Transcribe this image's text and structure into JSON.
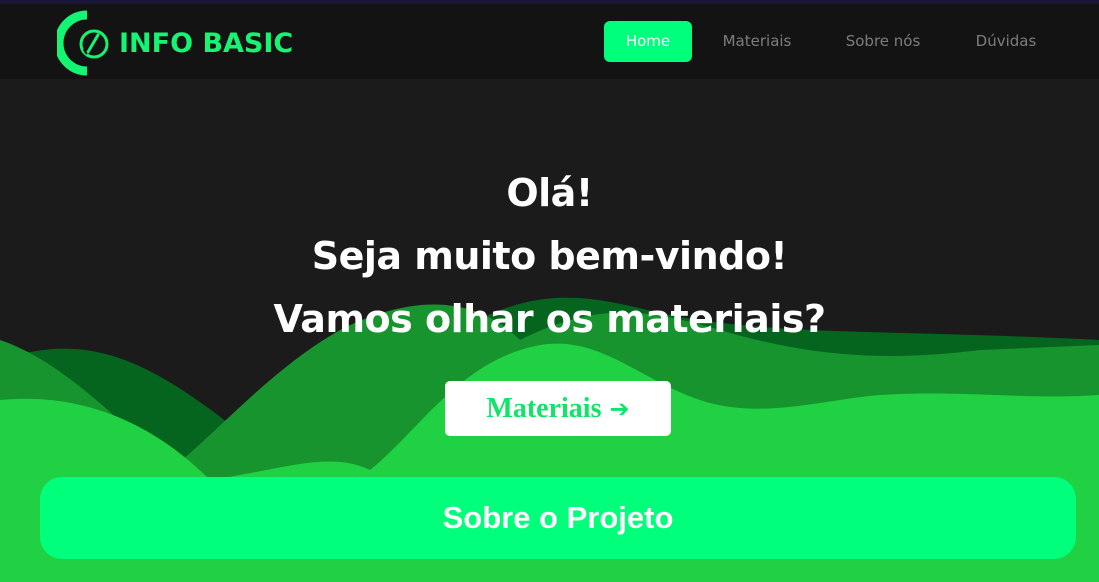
{
  "brand": {
    "name": "INFO BASIC",
    "logo_icon": "circle-power-icon",
    "accent_color": "#00ff7b"
  },
  "nav": {
    "items": [
      {
        "label": "Home",
        "active": true
      },
      {
        "label": "Materiais",
        "active": false
      },
      {
        "label": "Sobre nós",
        "active": false
      },
      {
        "label": "Dúvidas",
        "active": false
      }
    ]
  },
  "hero": {
    "lines": [
      "Olá!",
      "Seja muito bem-vindo!",
      "Vamos olhar os materiais?"
    ],
    "cta_label": "Materiais",
    "cta_icon": "arrow-right-icon"
  },
  "about": {
    "label": "Sobre o Projeto"
  },
  "colors": {
    "background": "#1b1b1b",
    "navbar": "#131313",
    "hill_dark": "#05651e",
    "hill_mid": "#17942e",
    "hill_light": "#20d144"
  }
}
